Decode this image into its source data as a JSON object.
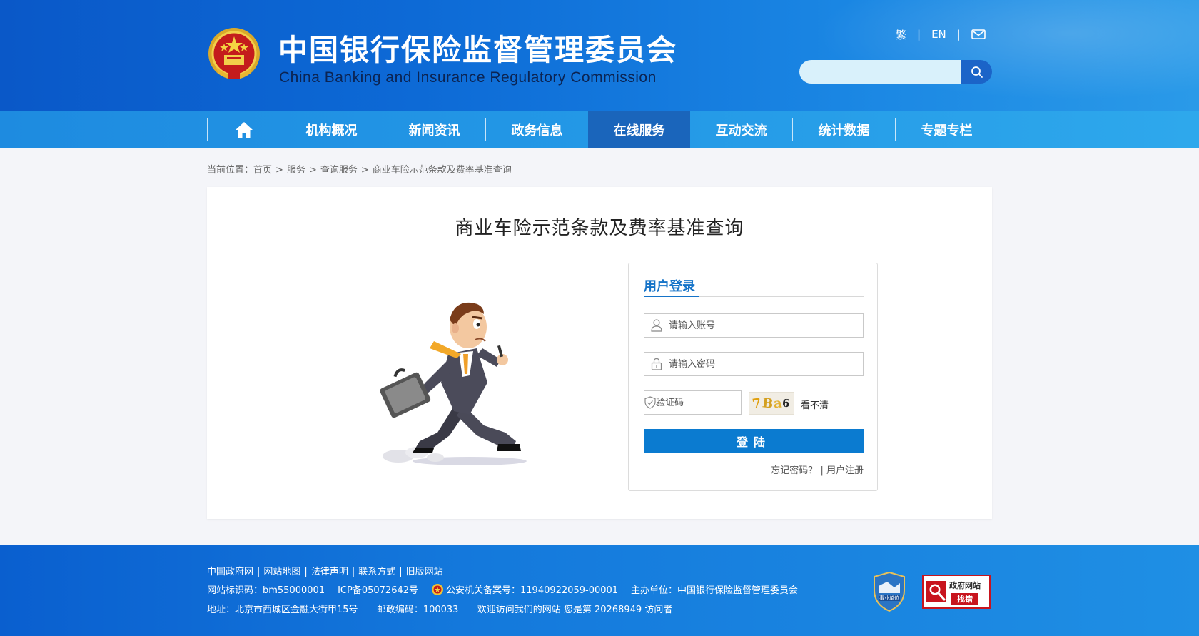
{
  "header": {
    "title_cn": "中国银行保险监督管理委员会",
    "title_en": "China Banking and Insurance Regulatory Commission",
    "lang_traditional": "繁",
    "lang_english": "EN",
    "search_placeholder": "",
    "icons": [
      "national-emblem-icon",
      "mail-icon",
      "search-icon"
    ]
  },
  "nav": {
    "items": [
      {
        "label": "机构概况"
      },
      {
        "label": "新闻资讯"
      },
      {
        "label": "政务信息"
      },
      {
        "label": "在线服务",
        "active": true
      },
      {
        "label": "互动交流"
      },
      {
        "label": "统计数据"
      },
      {
        "label": "专题专栏"
      }
    ]
  },
  "breadcrumb": {
    "prefix": "当前位置：",
    "items": [
      "首页",
      "服务",
      "查询服务",
      "商业车险示范条款及费率基准查询"
    ]
  },
  "main": {
    "title": "商业车险示范条款及费率基准查询"
  },
  "login": {
    "title": "用户登录",
    "account_placeholder": "请输入账号",
    "password_placeholder": "请输入密码",
    "captcha_placeholder": "验证码",
    "captcha_chars": [
      "7",
      "B",
      "a",
      "6"
    ],
    "refresh_label": "看不清",
    "submit_label": "登陆",
    "forgot_label": "忘记密码？",
    "link_sep": "|",
    "register_label": "用户注册"
  },
  "footer": {
    "links": [
      "中国政府网",
      "网站地图",
      "法律声明",
      "联系方式",
      "旧版网站"
    ],
    "site_id": "网站标识码：bm55000001",
    "icp": "ICP备05072642号",
    "police": "公安机关备案号：11940922059-00001",
    "sponsor": "主办单位：中国银行保险监督管理委员会",
    "address": "地址：北京市西城区金融大街甲15号",
    "postcode": "邮政编码：100033",
    "welcome": "欢迎访问我们的网站  您是第 20268949 访问者",
    "shield_badge_text": "事业单位",
    "find_error_line1": "政府网站",
    "find_error_line2": "找错"
  },
  "colors": {
    "header_blue": "#0d6ad6",
    "nav_active": "#1a65bb",
    "accent": "#1573c8",
    "button": "#0b7bd0",
    "page_bg": "#f4f5f9"
  }
}
